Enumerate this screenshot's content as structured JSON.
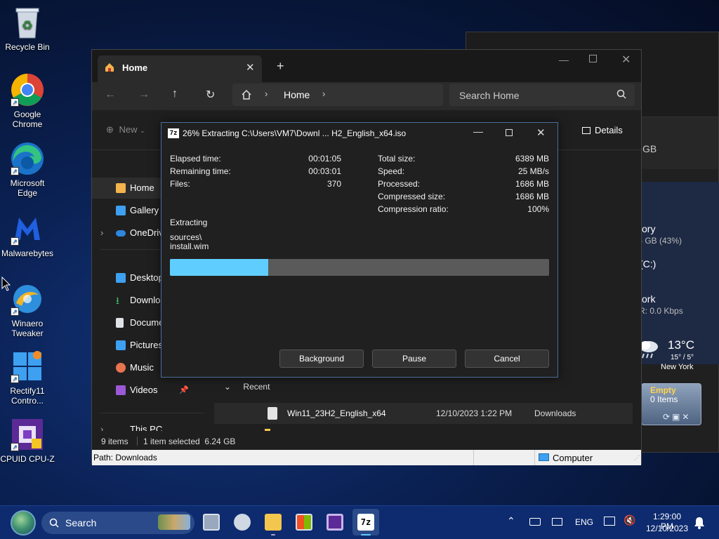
{
  "desktop": {
    "icons": [
      {
        "label": "Recycle Bin"
      },
      {
        "label": "Google Chrome"
      },
      {
        "label": "Microsoft Edge"
      },
      {
        "label": "Malwarebytes"
      },
      {
        "label": "Winaero Tweaker"
      },
      {
        "label": "Rectify11 Contro..."
      },
      {
        "label": "CPUID CPU-Z"
      }
    ]
  },
  "background_window": {
    "fragments": {
      "gb": "GB",
      "memory": "ory",
      "memory_value": ") GB (43%)",
      "drive": "(C:)",
      "network": "ork",
      "network_value": "R: 0.0 Kbps"
    }
  },
  "gadgets": {
    "weather": {
      "temp": "13°C",
      "range": "15° / 5°",
      "city": "New York"
    },
    "recycle": {
      "title": "Empty",
      "items": "0 Items"
    }
  },
  "explorer": {
    "tab_title": "Home",
    "address": {
      "location": "Home",
      "search_placeholder": "Search Home"
    },
    "command_bar": {
      "new_label": "New",
      "details_label": "Details"
    },
    "nav": [
      {
        "label": "Home"
      },
      {
        "label": "Gallery"
      },
      {
        "label": "OneDrive"
      },
      {
        "label": "Desktop"
      },
      {
        "label": "Downloads"
      },
      {
        "label": "Documents"
      },
      {
        "label": "Pictures"
      },
      {
        "label": "Music"
      },
      {
        "label": "Videos"
      },
      {
        "label": "This PC"
      }
    ],
    "recent_header": "Recent",
    "recent_files": [
      {
        "name": "Win11_23H2_English_x64",
        "date": "12/10/2023 1:22 PM",
        "location": "Downloads"
      }
    ],
    "status": {
      "count": "9 items",
      "selection": "1 item selected  6.24 GB"
    },
    "path_bar": {
      "path": "Path: Downloads",
      "computer": "Computer"
    }
  },
  "dialog": {
    "title_icon": "7z",
    "title": "26% Extracting C:\\Users\\VM7\\Downl ... H2_English_x64.iso",
    "left": {
      "elapsed_label": "Elapsed time:",
      "elapsed": "00:01:05",
      "remaining_label": "Remaining time:",
      "remaining": "00:03:01",
      "files_label": "Files:",
      "files": "370"
    },
    "right": {
      "total_label": "Total size:",
      "total": "6389 MB",
      "speed_label": "Speed:",
      "speed": "25 MB/s",
      "processed_label": "Processed:",
      "processed": "1686 MB",
      "compressed_label": "Compressed size:",
      "compressed": "1686 MB",
      "ratio_label": "Compression ratio:",
      "ratio": "100%"
    },
    "action": "Extracting",
    "current_folder": "sources\\",
    "current_file": "install.wim",
    "progress_fraction": 0.26,
    "buttons": {
      "background": "Background",
      "pause": "Pause",
      "cancel": "Cancel"
    }
  },
  "taskbar": {
    "search_label": "Search",
    "language": "ENG",
    "time": "1:29:00 PM",
    "date": "12/10/2023",
    "apps": [
      "task-view-icon",
      "weather-icon",
      "file-explorer-icon",
      "microsoft-store-icon",
      "cpu-z-icon",
      "7zip-icon"
    ]
  },
  "colors": {
    "accent": "#60cdff",
    "progress_track": "#5a5a5a",
    "taskbar": "#0d2b6e",
    "dialog_bg": "#202020"
  }
}
